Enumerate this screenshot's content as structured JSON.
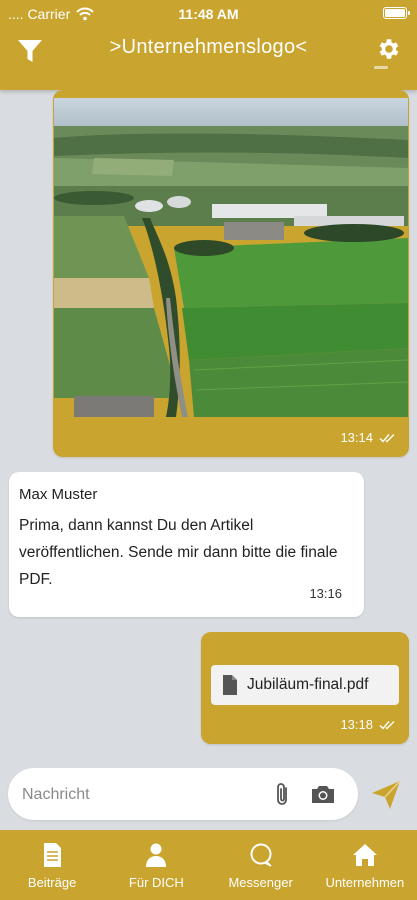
{
  "status_bar": {
    "carrier": ".... Carrier",
    "time": "11:48 AM"
  },
  "header": {
    "title": ">Unternehmenslogo<"
  },
  "messages": [
    {
      "type": "image",
      "direction": "outgoing",
      "time": "13:14"
    },
    {
      "type": "text",
      "direction": "incoming",
      "sender": "Max Muster",
      "text": "Prima, dann kannst Du den Artikel veröffentlichen. Sende mir dann bitte die finale PDF.",
      "time": "13:16"
    },
    {
      "type": "file",
      "direction": "outgoing",
      "filename": "Jubiläum-final.pdf",
      "time": "13:18"
    }
  ],
  "composer": {
    "placeholder": "Nachricht"
  },
  "tabs": [
    {
      "label": "Beiträge",
      "icon": "document-icon"
    },
    {
      "label": "Für DICH",
      "icon": "person-icon"
    },
    {
      "label": "Messenger",
      "icon": "chat-bubble-icon"
    },
    {
      "label": "Unternehmen",
      "icon": "home-icon"
    }
  ],
  "colors": {
    "accent": "#c9a42f",
    "background": "#d9dde1"
  }
}
